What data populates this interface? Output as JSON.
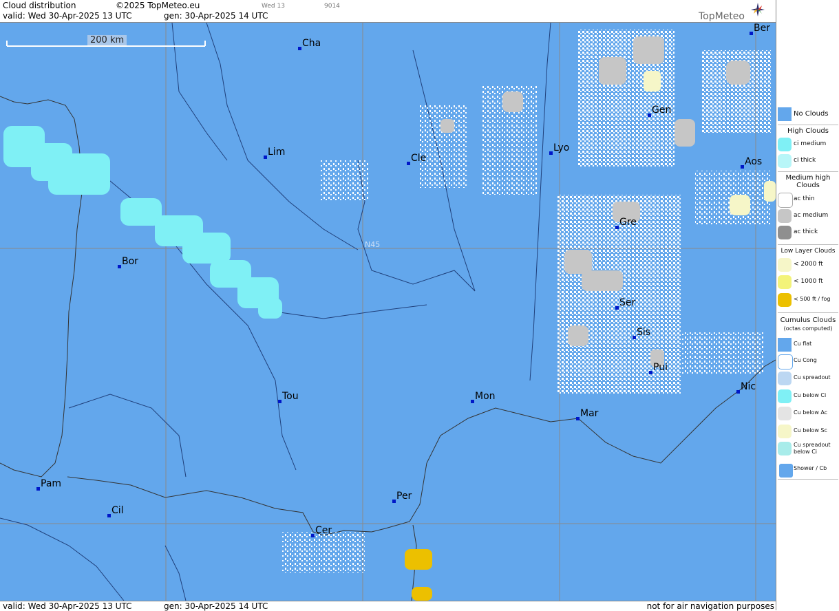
{
  "header": {
    "title": "Cloud distribution",
    "copyright": "©2025 TopMeteo.eu",
    "valid": "valid:  Wed  30-Apr-2025  13 UTC",
    "gen": "gen: 30-Apr-2025 14 UTC",
    "small_day": "Wed 13",
    "small_code": "9014",
    "logo": "TopMeteo"
  },
  "footer": {
    "valid": "valid:  Wed  30-Apr-2025  13 UTC",
    "gen": "gen: 30-Apr-2025 14 UTC",
    "disclaimer": "not for air navigation purposes"
  },
  "map": {
    "scale_label": "200 km",
    "parallel_label": "N45",
    "cities": [
      {
        "name": "Cha"
      },
      {
        "name": "Lim"
      },
      {
        "name": "Cle"
      },
      {
        "name": "Lyo"
      },
      {
        "name": "Gen"
      },
      {
        "name": "Ber"
      },
      {
        "name": "Aos"
      },
      {
        "name": "Gre"
      },
      {
        "name": "Bor"
      },
      {
        "name": "Ser"
      },
      {
        "name": "Sis"
      },
      {
        "name": "Pui"
      },
      {
        "name": "Nic"
      },
      {
        "name": "Tou"
      },
      {
        "name": "Mon"
      },
      {
        "name": "Mar"
      },
      {
        "name": "Pam"
      },
      {
        "name": "Cil"
      },
      {
        "name": "Per"
      },
      {
        "name": "Cer"
      }
    ]
  },
  "legend": {
    "no_clouds": "No Clouds",
    "high_clouds": "High Clouds",
    "ci_medium": "ci medium",
    "ci_thick": "ci thick",
    "medium_high_clouds": "Medium high Clouds",
    "ac_thin": "ac thin",
    "ac_medium": "ac medium",
    "ac_thick": "ac thick",
    "low_layer_clouds": "Low Layer Clouds",
    "low_2000": "< 2000 ft",
    "low_1000": "< 1000 ft",
    "low_500": "< 500 ft / fog",
    "cumulus_clouds": "Cumulus Clouds",
    "octas": "(octas computed)",
    "cu_flat": "Cu flat",
    "cu_cong": "Cu Cong",
    "cu_spreadout": "Cu spreadout",
    "cu_below_ci": "Cu below Ci",
    "cu_below_ac": "Cu below Ac",
    "cu_below_sc": "Cu below Sc",
    "cu_spreadout_below_ci": "Cu spreadout below Ci",
    "shower_cb": "Shower / Cb"
  },
  "colors": {
    "no_clouds": "#63a7ec",
    "ci": "#7ff0f5",
    "ac_medium": "#c6c6c6",
    "ac_thick": "#8f8f8f",
    "low_2000": "#f6f6c8",
    "low_1000": "#f3f37a",
    "fog": "#ecc000",
    "cu": "#ffffff",
    "city": "#0018c8"
  }
}
